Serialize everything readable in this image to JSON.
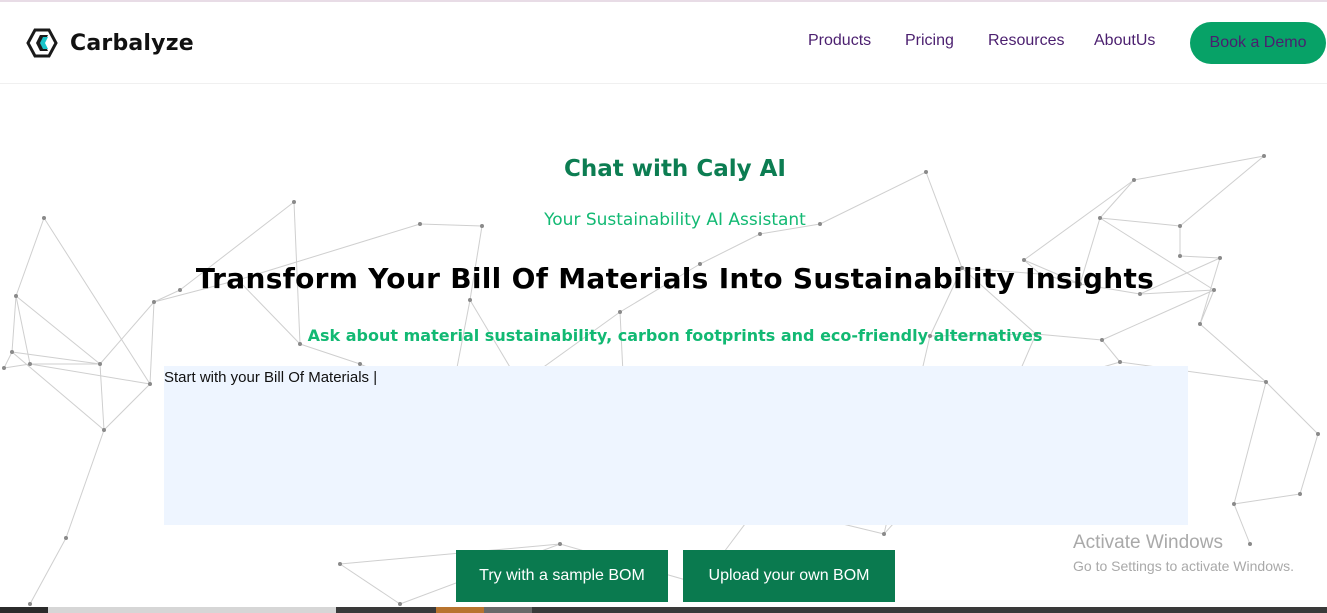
{
  "brand": {
    "name": "Carbalyze",
    "logo_icon": "hexagon-logo-icon",
    "accent_color": "#07a267"
  },
  "nav": {
    "items": [
      {
        "label": "Products"
      },
      {
        "label": "Pricing"
      },
      {
        "label": "Resources"
      },
      {
        "label": "AboutUs"
      }
    ],
    "cta_label": "Book a Demo"
  },
  "hero": {
    "title": "Chat with Caly AI",
    "subtitle": "Your Sustainability AI Assistant",
    "headline": "Transform Your Bill Of Materials Into Sustainability Insights",
    "description": "Ask about material sustainability, carbon footprints and eco-friendly alternatives",
    "input_placeholder": "Start with your Bill Of Materials |",
    "buttons": {
      "sample": "Try with a sample BOM",
      "upload": "Upload your own BOM"
    }
  },
  "overlay": {
    "activate_title": "Activate Windows",
    "activate_sub": "Go to Settings to activate Windows."
  },
  "colors": {
    "nav_text": "#4b1f6f",
    "title_green": "#0c7d52",
    "subtitle_green": "#12b973",
    "button_green": "#0a7a4f",
    "input_bg": "#eef5ff"
  }
}
